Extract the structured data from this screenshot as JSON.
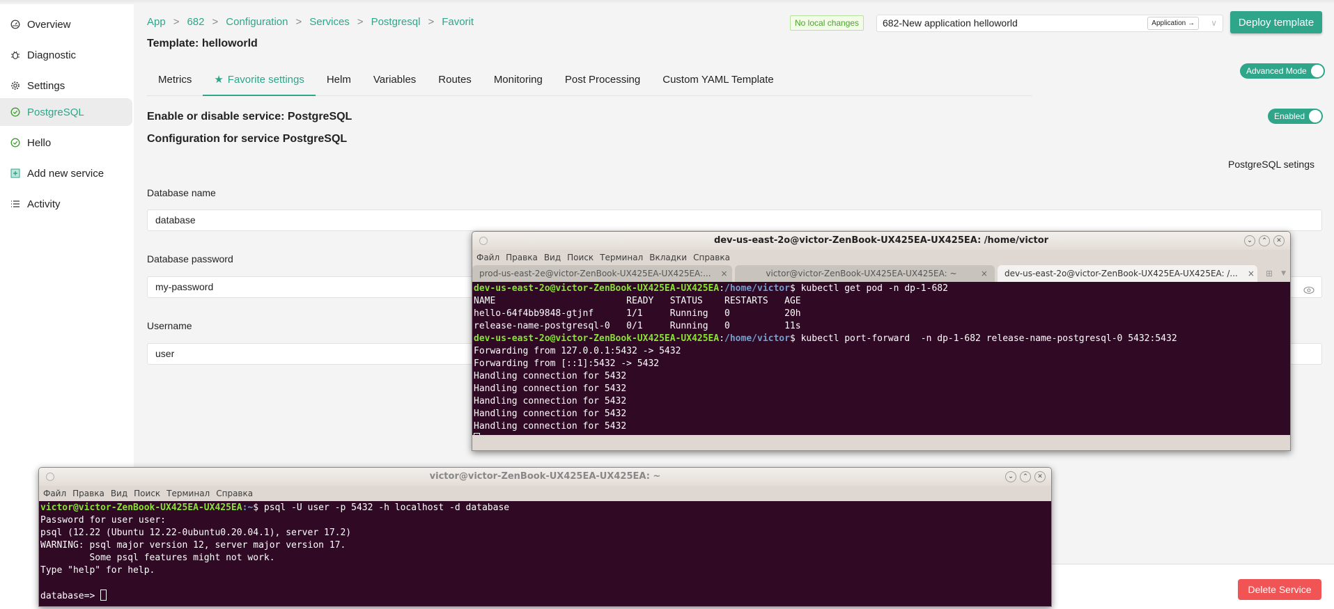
{
  "sidebar": {
    "items": [
      {
        "label": "Overview",
        "icon": "gauge-icon"
      },
      {
        "label": "Diagnostic",
        "icon": "bug-icon"
      },
      {
        "label": "Settings",
        "icon": "gear-icon"
      },
      {
        "label": "PostgreSQL",
        "icon": "check-circle-icon",
        "active": true
      },
      {
        "label": "Hello",
        "icon": "check-circle-icon"
      },
      {
        "label": "Add new service",
        "icon": "plus-square-icon"
      },
      {
        "label": "Activity",
        "icon": "list-icon"
      }
    ]
  },
  "header": {
    "breadcrumb": [
      "App",
      "682",
      "Configuration",
      "Services",
      "Postgresql",
      "Favorit"
    ],
    "breadcrumb_sep": ">",
    "template_title": "Template: helloworld",
    "status_badge": "No local changes",
    "app_select_value": "682-New application helloworld",
    "app_button": "Application →",
    "deploy_button": "Deploy template",
    "advanced_mode": {
      "label": "Advanced Mode",
      "on": true
    }
  },
  "tabs": [
    "Metrics",
    "Favorite settings",
    "Helm",
    "Variables",
    "Routes",
    "Monitoring",
    "Post Processing",
    "Custom YAML Template"
  ],
  "active_tab": "Favorite settings",
  "service": {
    "enable_title": "Enable or disable service: PostgreSQL",
    "enabled_toggle": {
      "label": "Enabled",
      "on": true
    },
    "config_title": "Configuration for service PostgreSQL",
    "settings_label": "PostgreSQL setings",
    "fields": [
      {
        "label": "Database name",
        "value": "database"
      },
      {
        "label": "Database password",
        "value": "my-password"
      },
      {
        "label": "Username",
        "value": "user"
      }
    ],
    "delete_button": "Delete Service"
  },
  "terminal_top": {
    "title": "dev-us-east-2o@victor-ZenBook-UX425EA-UX425EA: /home/victor",
    "menu": [
      "Файл",
      "Правка",
      "Вид",
      "Поиск",
      "Терминал",
      "Вкладки",
      "Справка"
    ],
    "tabs": [
      "prod-us-east-2e@victor-ZenBook-UX425EA-UX425EA:...",
      "victor@victor-ZenBook-UX425EA-UX425EA: ~",
      "dev-us-east-2o@victor-ZenBook-UX425EA-UX425EA: /..."
    ],
    "prompt_user": "dev-us-east-2o@victor-ZenBook-UX425EA-UX425EA",
    "prompt_path": "/home/victor",
    "cmd1": "$ kubectl get pod -n dp-1-682",
    "output1": [
      "NAME                        READY   STATUS    RESTARTS   AGE",
      "hello-64f4bb9848-gtjnf      1/1     Running   0          20h",
      "release-name-postgresql-0   0/1     Running   0          11s"
    ],
    "cmd2": "$ kubectl port-forward  -n dp-1-682 release-name-postgresql-0 5432:5432",
    "output2": [
      "Forwarding from 127.0.0.1:5432 -> 5432",
      "Forwarding from [::1]:5432 -> 5432",
      "Handling connection for 5432",
      "Handling connection for 5432",
      "Handling connection for 5432",
      "Handling connection for 5432",
      "Handling connection for 5432"
    ]
  },
  "terminal_bottom": {
    "title": "victor@victor-ZenBook-UX425EA-UX425EA: ~",
    "menu": [
      "Файл",
      "Правка",
      "Вид",
      "Поиск",
      "Терминал",
      "Справка"
    ],
    "prompt_user": "victor@victor-ZenBook-UX425EA-UX425EA",
    "prompt_path": ":~",
    "cmd": "$ psql -U user -p 5432 -h localhost -d database",
    "output": [
      "Password for user user:",
      "psql (12.22 (Ubuntu 12.22-0ubuntu0.20.04.1), server 17.2)",
      "WARNING: psql major version 12, server major version 17.",
      "         Some psql features might not work.",
      "Type \"help\" for help.",
      ""
    ],
    "final_prompt": "database=> "
  }
}
